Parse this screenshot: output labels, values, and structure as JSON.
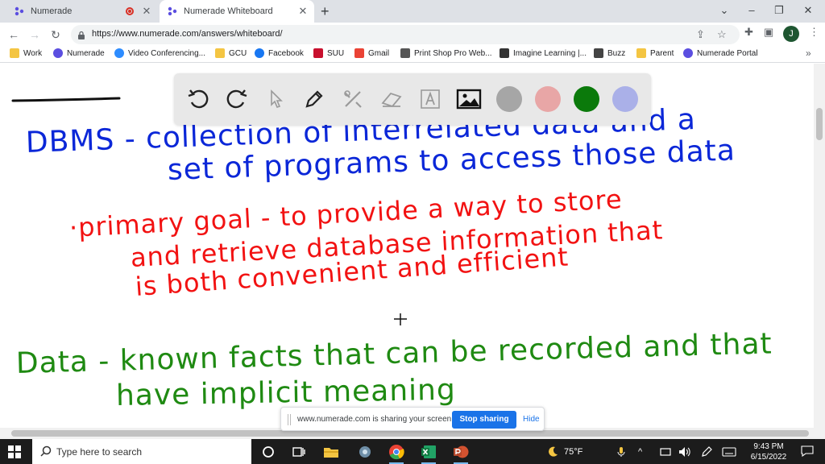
{
  "browser": {
    "tabs": [
      {
        "title": "Numerade",
        "recording": true
      },
      {
        "title": "Numerade Whiteboard",
        "active": true
      }
    ],
    "url": "https://www.numerade.com/answers/whiteboard/",
    "profile_initial": "J",
    "bookmarks": [
      {
        "label": "Work",
        "icon": "folder-icon",
        "color": "#f4c542"
      },
      {
        "label": "Numerade",
        "icon": "numerade-icon",
        "color": "#5b4ee0"
      },
      {
        "label": "Video Conferencing...",
        "icon": "video-icon",
        "color": "#2d8cff"
      },
      {
        "label": "GCU",
        "icon": "folder-icon",
        "color": "#f4c542"
      },
      {
        "label": "Facebook",
        "icon": "facebook-icon",
        "color": "#1877f2"
      },
      {
        "label": "SUU",
        "icon": "suu-icon",
        "color": "#c8102e"
      },
      {
        "label": "Gmail",
        "icon": "gmail-icon",
        "color": "#ea4335"
      },
      {
        "label": "Print Shop Pro Web...",
        "icon": "print-icon",
        "color": "#555555"
      },
      {
        "label": "Imagine Learning |...",
        "icon": "imagine-icon",
        "color": "#333333"
      },
      {
        "label": "Buzz",
        "icon": "buzz-icon",
        "color": "#444444"
      },
      {
        "label": "Parent",
        "icon": "folder-icon",
        "color": "#f4c542"
      },
      {
        "label": "Numerade Portal",
        "icon": "numerade-icon",
        "color": "#5b4ee0"
      }
    ],
    "bookmarks_more": "»"
  },
  "whiteboard": {
    "tools": [
      {
        "name": "undo-icon"
      },
      {
        "name": "redo-icon"
      },
      {
        "name": "pointer-icon"
      },
      {
        "name": "pen-icon"
      },
      {
        "name": "tools-icon"
      },
      {
        "name": "eraser-icon"
      },
      {
        "name": "text-icon"
      },
      {
        "name": "image-icon"
      }
    ],
    "colors": [
      "#a6a6a6",
      "#e8a6a6",
      "#0b7a0b",
      "#aab0e8"
    ],
    "notes": {
      "blue_1": "DBMS - collection of interrelated data and a",
      "blue_2": "set of programs to access those data",
      "red_1": "·primary goal - to provide a way to store",
      "red_2": "and retrieve database information that",
      "red_3": "is both convenient and efficient",
      "green_1": "Data - known facts that can be recorded and that",
      "green_2": "have implicit meaning"
    },
    "ink_colors": {
      "blue": "#0b27d8",
      "red": "#f21212",
      "green": "#1f8a12"
    }
  },
  "share_bar": {
    "message": "www.numerade.com is sharing your screen.",
    "stop_label": "Stop sharing",
    "hide_label": "Hide"
  },
  "taskbar": {
    "search_placeholder": "Type here to search",
    "weather": "75°F",
    "time": "9:43 PM",
    "date": "6/15/2022"
  }
}
